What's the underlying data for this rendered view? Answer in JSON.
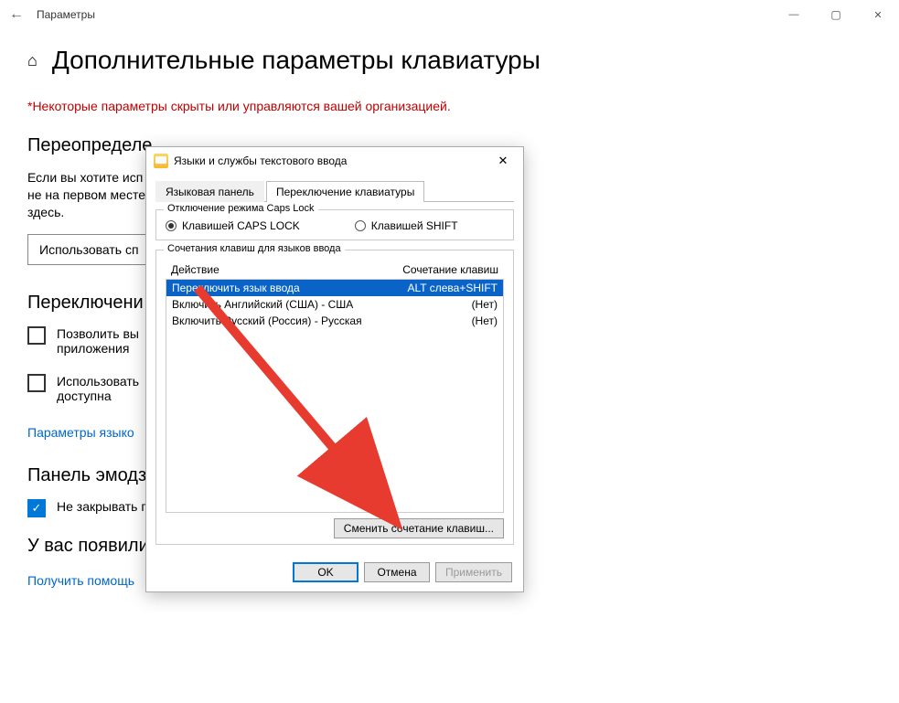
{
  "window": {
    "title": "Параметры"
  },
  "page": {
    "heading": "Дополнительные параметры клавиатуры",
    "policy": "*Некоторые параметры скрыты или управляются вашей организацией.",
    "section_override": "Переопределе",
    "override_text": "Если вы хотите исп\nне на первом месте\nздесь.",
    "override_button": "Использовать сп",
    "section_switch": "Переключени",
    "chk1": "Позволить вы\nприложения",
    "chk2": "Использовать\nдоступна",
    "link_lang": "Параметры языко",
    "section_emoji": "Панель эмодзи",
    "chk_emoji": "Не закрывать панель автоматически после ввода эмодзи",
    "section_help": "У вас появились вопросы?",
    "link_help": "Получить помощь"
  },
  "dialog": {
    "title": "Языки и службы текстового ввода",
    "tab_panel": "Языковая панель",
    "tab_switch": "Переключение клавиатуры",
    "caps_group": "Отключение режима Caps Lock",
    "caps_opt1": "Клавишей CAPS LOCK",
    "caps_opt2": "Клавишей SHIFT",
    "hotkey_group": "Сочетания клавиш для языков ввода",
    "col_action": "Действие",
    "col_keys": "Сочетание клавиш",
    "rows": [
      {
        "action": "Переключить язык ввода",
        "keys": "ALT слева+SHIFT"
      },
      {
        "action": "Включить Английский (США) - США",
        "keys": "(Нет)"
      },
      {
        "action": "Включить Русский (Россия) - Русская",
        "keys": "(Нет)"
      }
    ],
    "change_btn": "Сменить сочетание клавиш...",
    "ok": "OK",
    "cancel": "Отмена",
    "apply": "Применить"
  }
}
